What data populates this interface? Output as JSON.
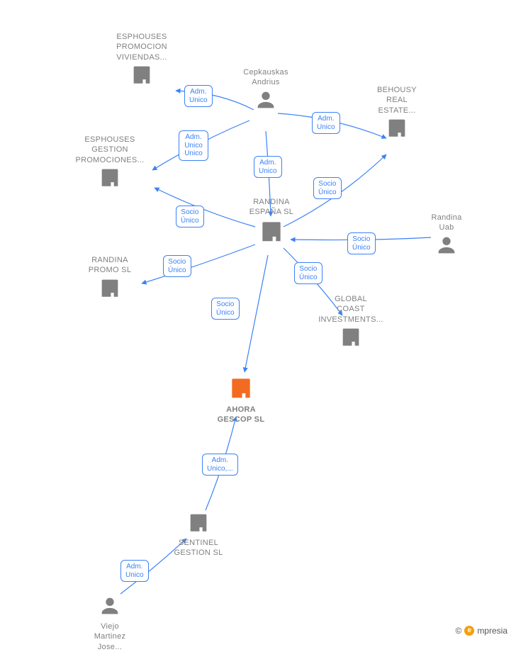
{
  "nodes": {
    "esphouses_prom": {
      "label": "ESPHOUSES PROMOCION VIVIENDAS...",
      "type": "company"
    },
    "cepkauskas": {
      "label": "Cepkauskas Andrius",
      "type": "person"
    },
    "behousy": {
      "label": "BEHOUSY REAL ESTATE...",
      "type": "company"
    },
    "esphouses_gest": {
      "label": "ESPHOUSES GESTION PROMOCIONES...",
      "type": "company"
    },
    "randina_esp": {
      "label": "RANDINA ESPAÑA SL",
      "type": "company"
    },
    "randina_uab": {
      "label": "Randina Uab",
      "type": "person"
    },
    "randina_promo": {
      "label": "RANDINA PROMO SL",
      "type": "company"
    },
    "global_coast": {
      "label": "GLOBAL COAST INVESTMENTS...",
      "type": "company"
    },
    "ahora": {
      "label": "AHORA GESCOP SL",
      "type": "company_highlight"
    },
    "sentinel": {
      "label": "SENTINEL GESTION SL",
      "type": "company"
    },
    "viejo": {
      "label": "Viejo Martinez Jose...",
      "type": "person"
    }
  },
  "edges": {
    "e_cep_esph_prom": {
      "text": "Adm. Unico"
    },
    "e_cep_esph_gest": {
      "text": "Adm. Unico Unico"
    },
    "e_cep_behousy": {
      "text": "Adm. Unico"
    },
    "e_cep_randina": {
      "text": "Adm. Unico"
    },
    "e_rand_behousy": {
      "text": "Socio Único"
    },
    "e_rand_esphg": {
      "text": "Socio Único"
    },
    "e_rand_promo": {
      "text": "Socio Único"
    },
    "e_rand_global": {
      "text": "Socio Único"
    },
    "e_rand_ahora": {
      "text": "Socio Único"
    },
    "e_uab_rand": {
      "text": "Socio Único"
    },
    "e_sent_ahora": {
      "text": "Adm. Unico,..."
    },
    "e_viejo_sent": {
      "text": "Adm. Unico"
    }
  },
  "footer": {
    "copyright": "©",
    "brand_letter": "e",
    "brand_text": "mpresia"
  }
}
